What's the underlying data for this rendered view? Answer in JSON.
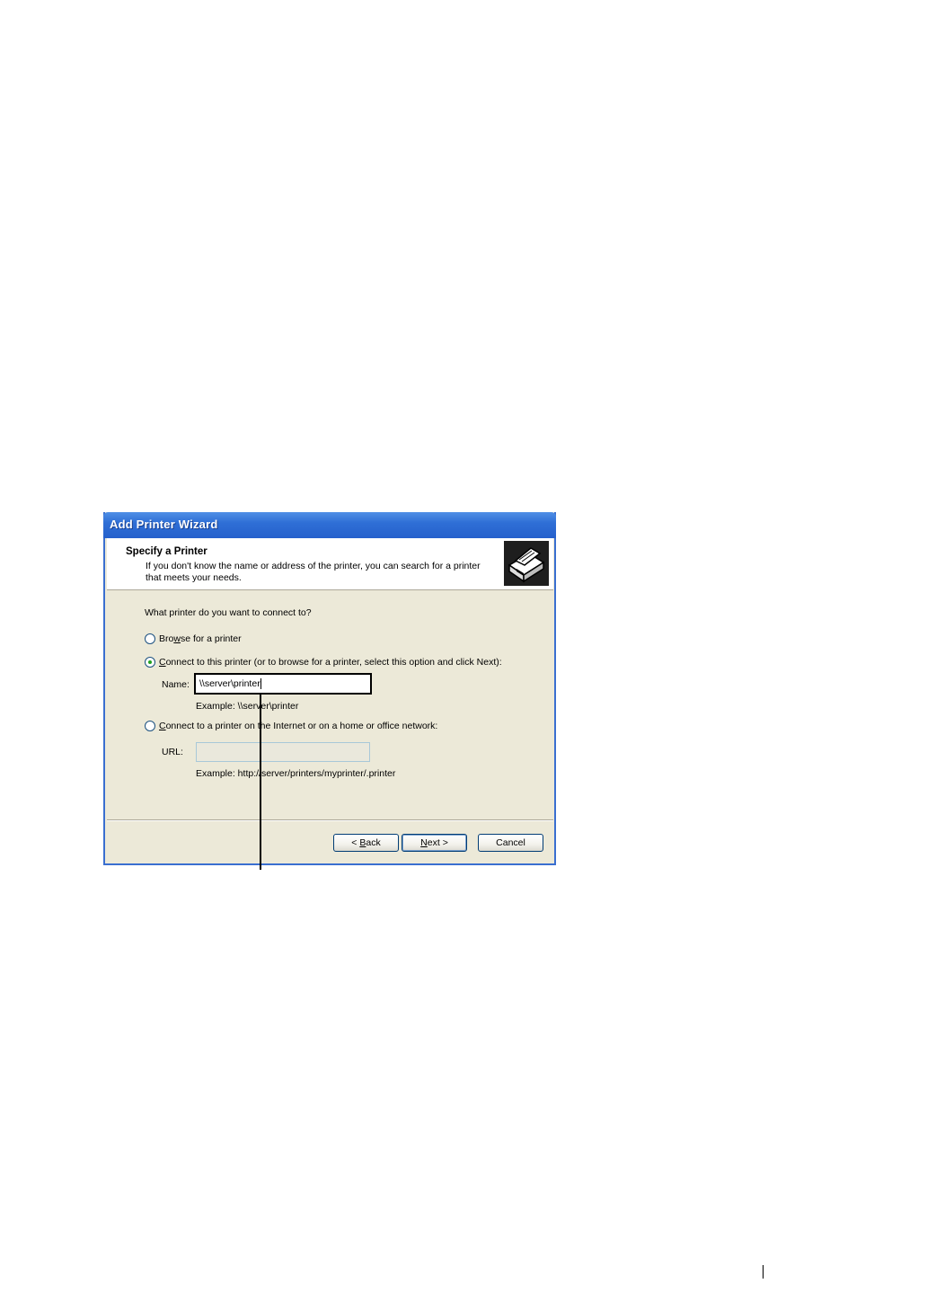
{
  "window": {
    "title": "Add Printer Wizard"
  },
  "header": {
    "title": "Specify a Printer",
    "description_line1": "If you don't know the name or address of the printer, you can search for a printer",
    "description_line2": "that meets your needs.",
    "icon": "printer-icon"
  },
  "question": "What printer do you want to connect to?",
  "options": {
    "browse": {
      "label_pre": "Bro",
      "label_key": "w",
      "label_post": "se for a printer",
      "selected": false
    },
    "connect_named": {
      "label_pre": "",
      "label_key": "C",
      "label_post": "onnect to this printer (or to browse for a printer, select this option and click Next):",
      "selected": true
    },
    "connect_internet": {
      "label_pre": "",
      "label_key": "C",
      "label_post": "onnect to a printer on the Internet or on a home or office network:",
      "selected": false
    }
  },
  "name_field": {
    "label": "Name:",
    "value": "\\\\server\\printer",
    "example": "Example: \\\\server\\printer"
  },
  "url_field": {
    "label": "URL:",
    "value": "",
    "example": "Example: http://server/printers/myprinter/.printer"
  },
  "buttons": {
    "back": {
      "pre": "< ",
      "key": "B",
      "post": "ack"
    },
    "next": {
      "pre": "",
      "key": "N",
      "post": "ext >"
    },
    "cancel": {
      "label": "Cancel"
    }
  },
  "colors": {
    "titlebar": "#2560cc",
    "dialog_bg": "#ece9d8",
    "radio_dot": "#21a121"
  }
}
